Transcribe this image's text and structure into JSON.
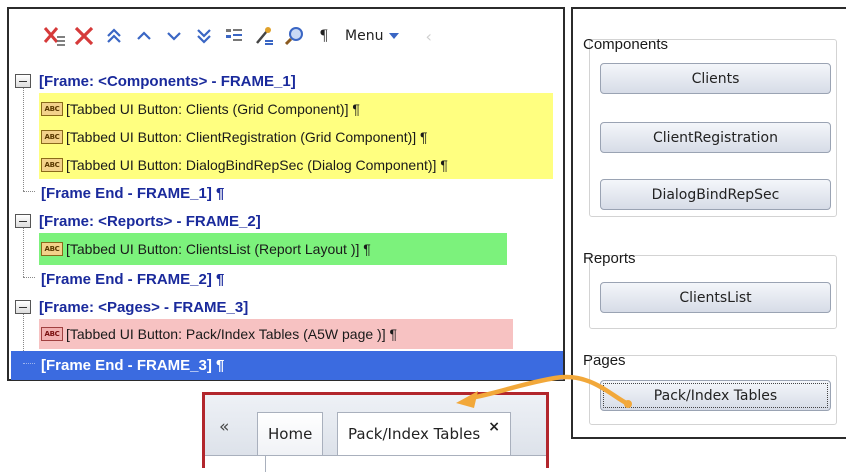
{
  "toolbar": {
    "menu_label": "Menu",
    "icons": [
      "delete-all-icon",
      "delete-icon",
      "move-top-icon",
      "move-up-icon",
      "move-down-icon",
      "move-bottom-icon",
      "properties-icon",
      "edit-icon",
      "search-icon",
      "pilcrow-icon"
    ],
    "pilcrow": "¶"
  },
  "tree": {
    "frame1": {
      "label": "[Frame: <Components> - FRAME_1]",
      "items": [
        "[Tabbed UI Button: Clients (Grid Component)] ¶",
        "[Tabbed UI Button: ClientRegistration (Grid Component)] ¶",
        "[Tabbed UI Button: DialogBindRepSec (Dialog Component)] ¶"
      ],
      "end": "[Frame End - FRAME_1] ¶"
    },
    "frame2": {
      "label": "[Frame: <Reports> - FRAME_2]",
      "items": [
        "[Tabbed UI Button: ClientsList  (Report Layout )] ¶"
      ],
      "end": "[Frame End - FRAME_2] ¶"
    },
    "frame3": {
      "label": "[Frame: <Pages> - FRAME_3]",
      "items": [
        "[Tabbed UI Button: Pack/Index Tables (A5W page )] ¶"
      ],
      "end": "[Frame End - FRAME_3] ¶"
    },
    "abc_badge": "ABC"
  },
  "colors": {
    "highlight_yellow": "#ffff80",
    "highlight_green": "#7cf27c",
    "highlight_pink": "#f7c2c2",
    "selection_blue": "#3b6be0",
    "frame_text": "#1a2a9c",
    "arrow_orange": "#f2a83a",
    "tab_border_red": "#b2262c"
  },
  "panel": {
    "components_title": "Components",
    "components_buttons": [
      "Clients",
      "ClientRegistration",
      "DialogBindRepSec"
    ],
    "reports_title": "Reports",
    "reports_buttons": [
      "ClientsList"
    ],
    "pages_title": "Pages",
    "pages_buttons": [
      "Pack/Index Tables"
    ]
  },
  "tabs": {
    "chevron": "«",
    "home": "Home",
    "pack": "Pack/Index Tables",
    "close": "×"
  }
}
